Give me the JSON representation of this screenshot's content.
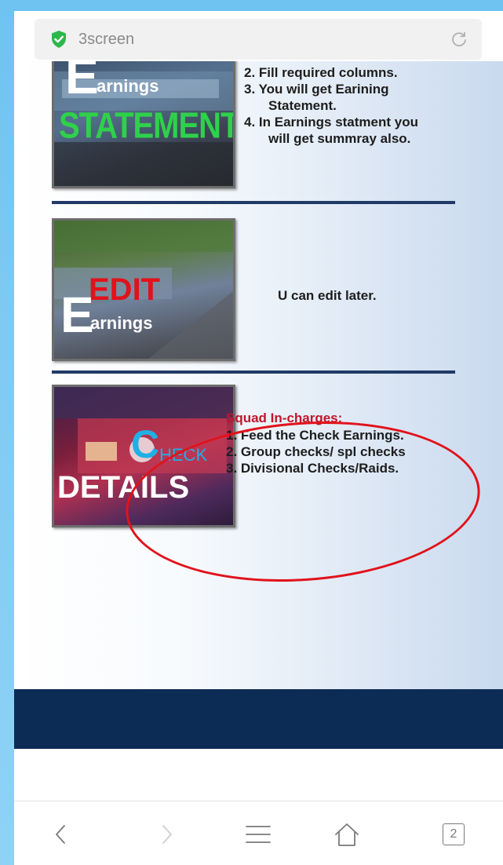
{
  "browser": {
    "url": "3screen",
    "tab_count": "2"
  },
  "slide": {
    "section1": {
      "thumb_letter": "E",
      "thumb_word": "arnings",
      "thumb_caption": "STATEMENT",
      "steps": [
        "2. Fill required columns.",
        "3. You will get Earining",
        "Statement.",
        "4. In Earnings statment you",
        "will get summray also."
      ]
    },
    "section2": {
      "thumb_title": "EDIT",
      "thumb_letter": "E",
      "thumb_word": "arnings",
      "note": "U can edit later."
    },
    "section3": {
      "thumb_letter": "C",
      "thumb_word": "HECK",
      "thumb_caption": "DETAILS",
      "heading": "Squad In-charges:",
      "steps": [
        "1. Feed the Check Earnings.",
        "2. Group checks/ spl checks",
        "3. Divisional Checks/Raids."
      ]
    }
  },
  "colors": {
    "accent_green": "#2fd14a",
    "accent_red": "#e1121b",
    "navy": "#0d2c55"
  }
}
